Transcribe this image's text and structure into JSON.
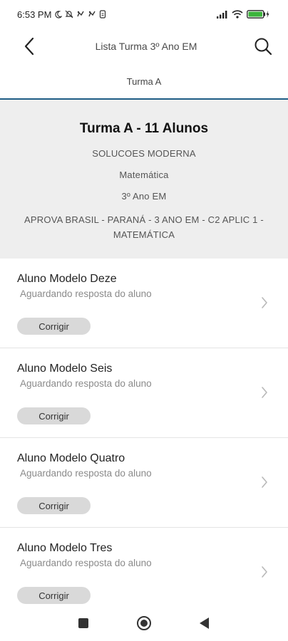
{
  "status_bar": {
    "time": "6:53 PM",
    "icons": [
      "moon-icon",
      "bell-off-icon",
      "app-notification-icon",
      "app-notification-icon",
      "sim-icon"
    ],
    "right_icons": [
      "signal-icon",
      "wifi-icon",
      "battery-charging-icon"
    ]
  },
  "app_bar": {
    "title": "Lista Turma 3º Ano EM"
  },
  "tab": {
    "label": "Turma A",
    "accent_color": "#1f5d86"
  },
  "class_card": {
    "title": "Turma A - 11 Alunos",
    "school": "SOLUCOES MODERNA",
    "subject": "Matemática",
    "grade": "3º Ano EM",
    "assessment": "APROVA BRASIL - PARANÁ - 3 ANO EM - C2 APLIC 1 - MATEMÁTICA"
  },
  "students": [
    {
      "name": "Aluno Modelo Deze",
      "status": "Aguardando resposta do aluno",
      "action": "Corrigir"
    },
    {
      "name": "Aluno Modelo Seis",
      "status": "Aguardando resposta do aluno",
      "action": "Corrigir"
    },
    {
      "name": "Aluno Modelo Quatro",
      "status": "Aguardando resposta do aluno",
      "action": "Corrigir"
    },
    {
      "name": "Aluno Modelo Tres",
      "status": "Aguardando resposta do aluno",
      "action": "Corrigir"
    }
  ]
}
